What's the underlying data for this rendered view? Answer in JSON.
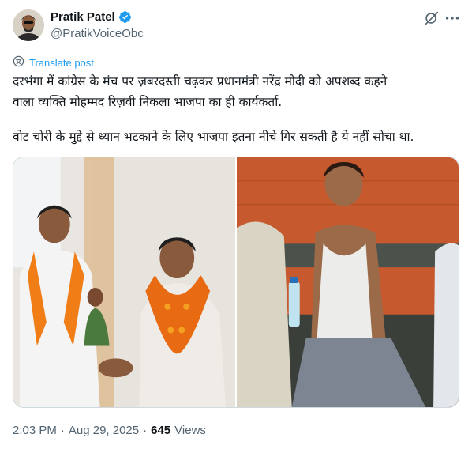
{
  "author": {
    "display_name": "Pratik Patel",
    "handle": "@PratikVoiceObc",
    "verified": true
  },
  "icons": {
    "verified": "verified-badge-icon",
    "grok": "grok-icon",
    "more": "more-icon",
    "translate": "translate-icon"
  },
  "translate": {
    "label": "Translate post"
  },
  "tweet": {
    "line1": "दरभंगा में कांग्रेस के मंच पर ज़बरदस्ती चढ़कर प्रधानमंत्री नरेंद्र मोदी को अपशब्द कहने",
    "line2": "वाला व्यक्ति मोहम्मद रिज़वी निकला भाजपा का ही कार्यकर्ता.",
    "line3": "वोट चोरी के मुद्दे से ध्यान भटकाने के लिए भाजपा इतना नीचे गिर सकती है ये नहीं सोचा था."
  },
  "meta": {
    "time": "2:03 PM",
    "dot1": "·",
    "date": "Aug 29, 2025",
    "dot2": "·",
    "views": "645",
    "views_label": "Views"
  },
  "colors": {
    "accent": "#1d9bf0",
    "secondary_text": "#536471",
    "primary_text": "#0f1419"
  }
}
